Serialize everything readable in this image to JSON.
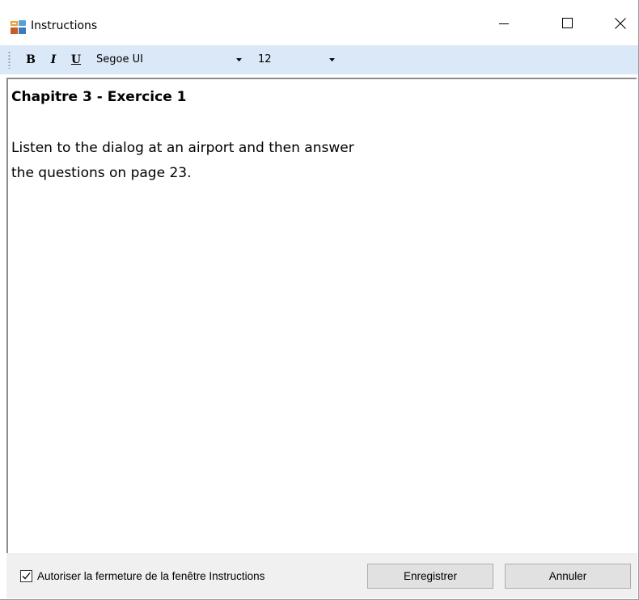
{
  "window": {
    "title": "Instructions"
  },
  "toolbar": {
    "bold_label": "B",
    "italic_label": "I",
    "underline_label": "U",
    "font_name": "Segoe UI",
    "font_size": "12"
  },
  "document": {
    "heading": "Chapitre 3 - Exercice 1",
    "lines": [
      "Listen to the dialog at an airport and then answer",
      "the questions on page 23."
    ]
  },
  "footer": {
    "checkbox_label": "Autoriser la fermeture de la fenêtre Instructions",
    "checkbox_checked": true,
    "save_label": "Enregistrer",
    "cancel_label": "Annuler"
  },
  "icons": {
    "app": "instructions-app-icon",
    "minimize": "minimize-icon",
    "maximize": "maximize-icon",
    "close": "close-icon",
    "dropdown": "chevron-down-icon",
    "check": "checkmark-icon"
  },
  "colors": {
    "toolbar_bg": "#dbe8f7",
    "footer_bg": "#f0f0f0",
    "button_bg": "#e1e1e1",
    "button_border": "#adadad"
  }
}
